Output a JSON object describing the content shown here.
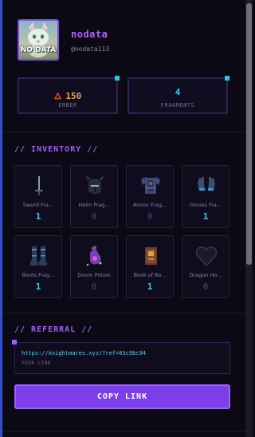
{
  "profile": {
    "username": "nodata",
    "handle": "@nodata113",
    "avatar_text": "NO DATA"
  },
  "stats": [
    {
      "value": "150",
      "label": "EMBER",
      "icon": "flame-icon",
      "color": "#f2a341"
    },
    {
      "value": "4",
      "label": "FRAGMENTS",
      "color": "#35c9ef"
    }
  ],
  "inventory": {
    "title": "// INVENTORY //",
    "items": [
      {
        "name": "Sword Fra...",
        "count": "1",
        "icon": "sword-icon"
      },
      {
        "name": "Helm Frag...",
        "count": "0",
        "icon": "helm-icon"
      },
      {
        "name": "Armor Frag...",
        "count": "0",
        "icon": "armor-icon"
      },
      {
        "name": "Gloves Fra...",
        "count": "1",
        "icon": "gloves-icon"
      },
      {
        "name": "Boots Frag...",
        "count": "1",
        "icon": "boots-icon"
      },
      {
        "name": "Doom Potion",
        "count": "0",
        "icon": "potion-icon"
      },
      {
        "name": "Book of Ro...",
        "count": "1",
        "icon": "book-icon"
      },
      {
        "name": "Dragon Ho...",
        "count": "0",
        "icon": "dragon-heart-icon"
      }
    ]
  },
  "referral": {
    "title": "// REFERRAL //",
    "link": "https://knightmares.xyz/?ref=03c9bc94",
    "sublabel": "YOUR LINK",
    "button_label": "COPY LINK"
  }
}
